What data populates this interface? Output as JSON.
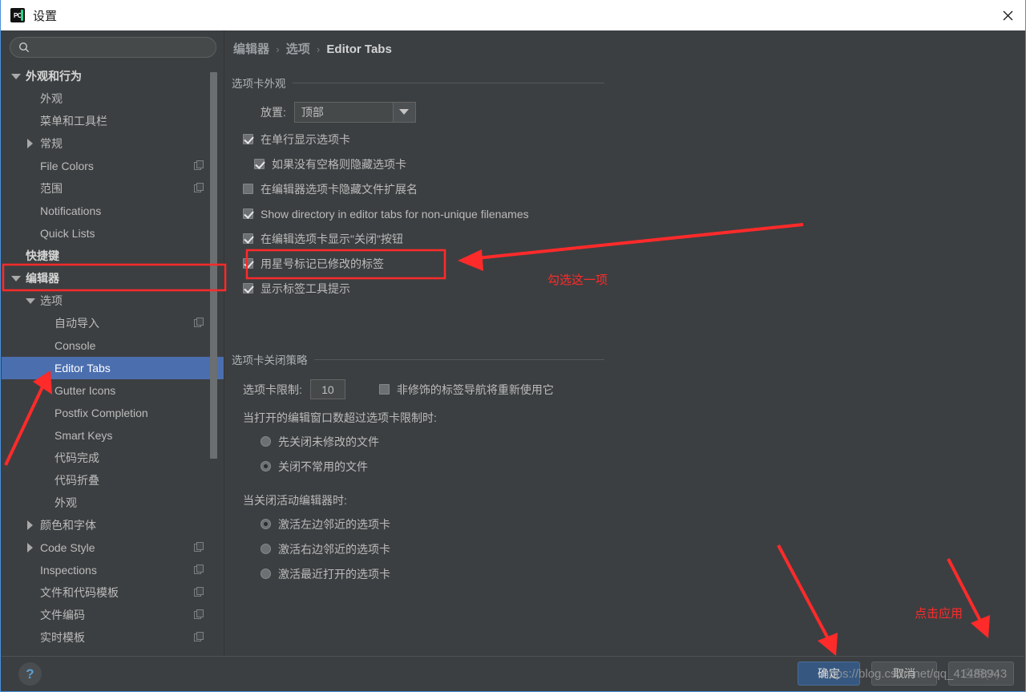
{
  "window": {
    "title": "设置",
    "app_icon": "pycharm-icon",
    "close_icon": "close-icon",
    "accent": "#4b6eaf",
    "bg": "#3c3f41"
  },
  "search": {
    "value": "",
    "placeholder": "",
    "icon": "search-icon"
  },
  "sidebar": {
    "items": [
      {
        "label": "外观和行为",
        "indent": 0,
        "twisty": "down",
        "bold": true,
        "copy": false,
        "selected": false
      },
      {
        "label": "外观",
        "indent": 1,
        "twisty": "none",
        "bold": false,
        "copy": false,
        "selected": false
      },
      {
        "label": "菜单和工具栏",
        "indent": 1,
        "twisty": "none",
        "bold": false,
        "copy": false,
        "selected": false
      },
      {
        "label": "常规",
        "indent": 1,
        "twisty": "right",
        "bold": false,
        "copy": false,
        "selected": false
      },
      {
        "label": "File Colors",
        "indent": 1,
        "twisty": "none",
        "bold": false,
        "copy": true,
        "selected": false
      },
      {
        "label": "范围",
        "indent": 1,
        "twisty": "none",
        "bold": false,
        "copy": true,
        "selected": false
      },
      {
        "label": "Notifications",
        "indent": 1,
        "twisty": "none",
        "bold": false,
        "copy": false,
        "selected": false
      },
      {
        "label": "Quick Lists",
        "indent": 1,
        "twisty": "none",
        "bold": false,
        "copy": false,
        "selected": false
      },
      {
        "label": "快捷键",
        "indent": 0,
        "twisty": "none",
        "bold": true,
        "copy": false,
        "selected": false
      },
      {
        "label": "编辑器",
        "indent": 0,
        "twisty": "down",
        "bold": true,
        "copy": false,
        "selected": false
      },
      {
        "label": "选项",
        "indent": 1,
        "twisty": "down",
        "bold": false,
        "copy": false,
        "selected": false
      },
      {
        "label": "自动导入",
        "indent": 2,
        "twisty": "none",
        "bold": false,
        "copy": true,
        "selected": false
      },
      {
        "label": "Console",
        "indent": 2,
        "twisty": "none",
        "bold": false,
        "copy": false,
        "selected": false
      },
      {
        "label": "Editor Tabs",
        "indent": 2,
        "twisty": "none",
        "bold": false,
        "copy": false,
        "selected": true
      },
      {
        "label": "Gutter Icons",
        "indent": 2,
        "twisty": "none",
        "bold": false,
        "copy": false,
        "selected": false
      },
      {
        "label": "Postfix Completion",
        "indent": 2,
        "twisty": "none",
        "bold": false,
        "copy": false,
        "selected": false
      },
      {
        "label": "Smart Keys",
        "indent": 2,
        "twisty": "none",
        "bold": false,
        "copy": false,
        "selected": false
      },
      {
        "label": "代码完成",
        "indent": 2,
        "twisty": "none",
        "bold": false,
        "copy": false,
        "selected": false
      },
      {
        "label": "代码折叠",
        "indent": 2,
        "twisty": "none",
        "bold": false,
        "copy": false,
        "selected": false
      },
      {
        "label": "外观",
        "indent": 2,
        "twisty": "none",
        "bold": false,
        "copy": false,
        "selected": false
      },
      {
        "label": "颜色和字体",
        "indent": 1,
        "twisty": "right",
        "bold": false,
        "copy": false,
        "selected": false
      },
      {
        "label": "Code Style",
        "indent": 1,
        "twisty": "right",
        "bold": false,
        "copy": true,
        "selected": false
      },
      {
        "label": "Inspections",
        "indent": 1,
        "twisty": "none",
        "bold": false,
        "copy": true,
        "selected": false
      },
      {
        "label": "文件和代码模板",
        "indent": 1,
        "twisty": "none",
        "bold": false,
        "copy": true,
        "selected": false
      },
      {
        "label": "文件编码",
        "indent": 1,
        "twisty": "none",
        "bold": false,
        "copy": true,
        "selected": false
      },
      {
        "label": "实时模板",
        "indent": 1,
        "twisty": "none",
        "bold": false,
        "copy": true,
        "selected": false
      }
    ]
  },
  "breadcrumb": {
    "part1": "编辑器",
    "part2": "选项",
    "part3": "Editor Tabs",
    "separator": "›"
  },
  "appearance_group": {
    "title": "选项卡外观",
    "placement_label": "放置:",
    "placement_value": "顶部",
    "checkboxes": [
      {
        "label": "在单行显示选项卡",
        "checked": true,
        "indent": 0
      },
      {
        "label": "如果没有空格则隐藏选项卡",
        "checked": true,
        "indent": 1
      },
      {
        "label": "在编辑器选项卡隐藏文件扩展名",
        "checked": false,
        "indent": 0
      },
      {
        "label": "Show directory in editor tabs for non-unique filenames",
        "checked": true,
        "indent": 0
      },
      {
        "label": "在编辑选项卡显示\"关闭\"按钮",
        "checked": true,
        "indent": 0
      },
      {
        "label": "用星号标记已修改的标签",
        "checked": true,
        "indent": 0
      },
      {
        "label": "显示标签工具提示",
        "checked": true,
        "indent": 0
      }
    ]
  },
  "closing_group": {
    "title": "选项卡关闭策略",
    "tab_limit_label": "选项卡限制:",
    "tab_limit_value": "10",
    "reuse_checkbox": {
      "label": "非修饰的标签导航将重新使用它",
      "checked": false
    },
    "over_limit_label": "当打开的编辑窗口数超过选项卡限制时:",
    "over_limit_options": [
      {
        "label": "先关闭未修改的文件",
        "selected": false
      },
      {
        "label": "关闭不常用的文件",
        "selected": true
      }
    ],
    "on_close_label": "当关闭活动编辑器时:",
    "on_close_options": [
      {
        "label": "激活左边邻近的选项卡",
        "selected": true
      },
      {
        "label": "激活右边邻近的选项卡",
        "selected": false
      },
      {
        "label": "激活最近打开的选项卡",
        "selected": false
      }
    ]
  },
  "footer": {
    "help_label": "?",
    "ok_label": "确定",
    "cancel_label": "取消",
    "apply_label": "应用(A)"
  },
  "annotations": {
    "color": "#ff2a2a",
    "note_check_this": "勾选这一项",
    "note_click_apply": "点击应用",
    "watermark": "https://blog.csdn.net/qq_41488943"
  }
}
